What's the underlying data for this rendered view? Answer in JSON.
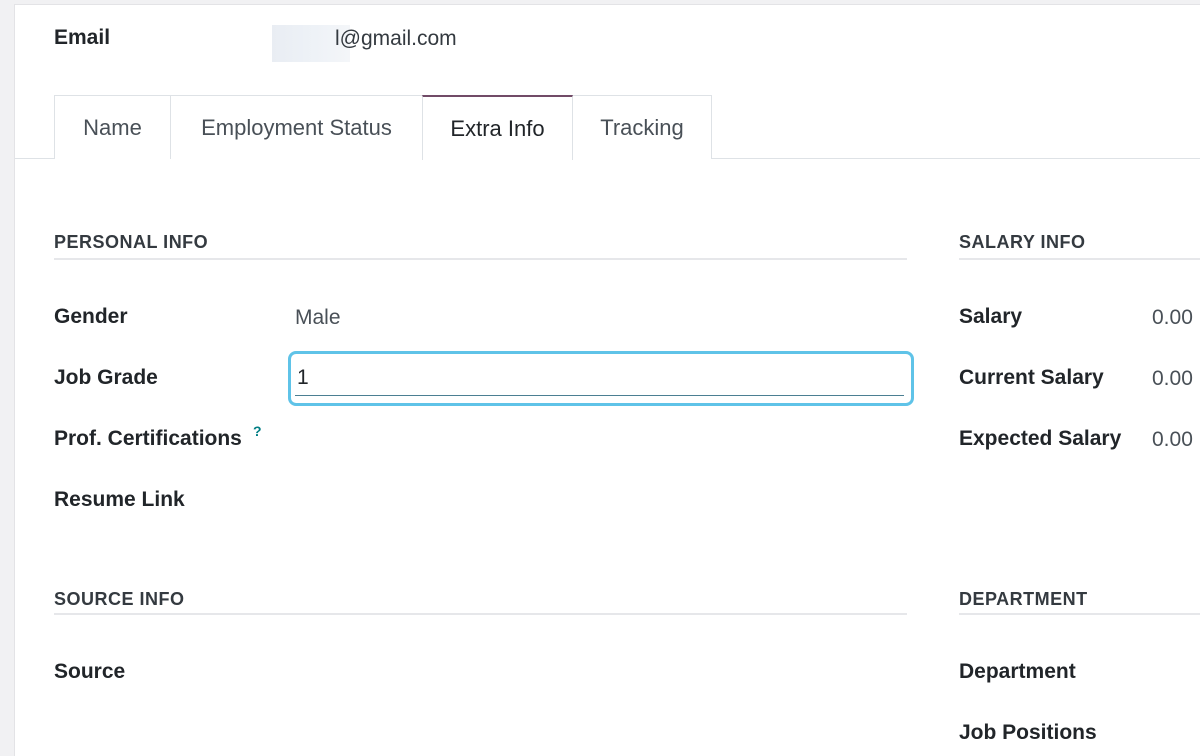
{
  "email": {
    "label": "Email",
    "value_visible": "l@gmail.com"
  },
  "tabs": [
    {
      "label": "Name",
      "active": false
    },
    {
      "label": "Employment Status",
      "active": false
    },
    {
      "label": "Extra Info",
      "active": true
    },
    {
      "label": "Tracking",
      "active": false
    }
  ],
  "personal_info": {
    "title": "PERSONAL INFO",
    "gender": {
      "label": "Gender",
      "value": "Male"
    },
    "job_grade": {
      "label": "Job Grade",
      "value": "1"
    },
    "prof_certifications": {
      "label": "Prof. Certifications",
      "help": "?"
    },
    "resume_link": {
      "label": "Resume Link"
    }
  },
  "salary_info": {
    "title": "SALARY INFO",
    "salary": {
      "label": "Salary",
      "value": "0.00"
    },
    "current_salary": {
      "label": "Current Salary",
      "value": "0.00"
    },
    "expected_salary": {
      "label": "Expected Salary",
      "value": "0.00"
    }
  },
  "source_info": {
    "title": "SOURCE INFO",
    "source": {
      "label": "Source"
    }
  },
  "department": {
    "title": "DEPARTMENT",
    "department": {
      "label": "Department"
    },
    "job_positions": {
      "label": "Job Positions"
    }
  },
  "colors": {
    "accent_tab": "#714b67",
    "input_focus": "#5fc3e8",
    "help_icon": "#017e84"
  }
}
